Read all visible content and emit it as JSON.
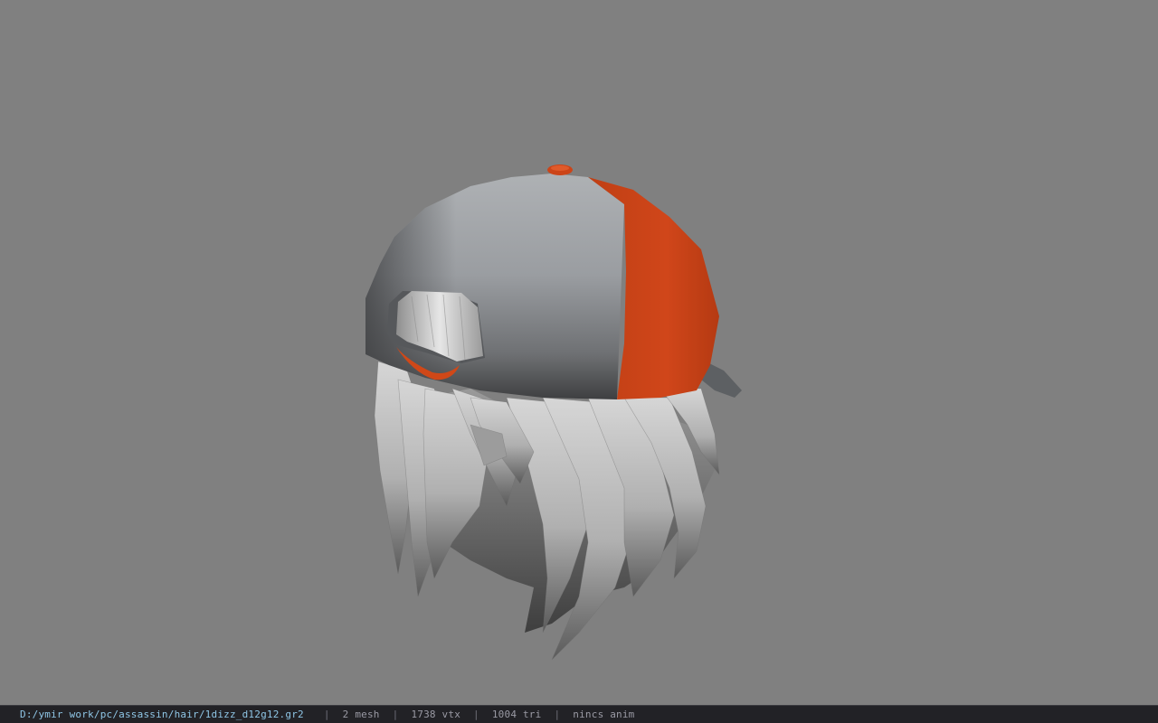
{
  "viewport": {
    "background_color": "#808080",
    "model": {
      "description_icon": "cap-with-hair-model",
      "cap_grey": "#a4a6a8",
      "cap_orange": "#cc4418",
      "hair_grey": "#b8b8b8"
    }
  },
  "status_bar": {
    "file_path": "D:/ymir work/pc/assassin/hair/1dizz_d12g12.gr2",
    "separator": "|",
    "mesh_count": "2 mesh",
    "vertex_count": "1738 vtx",
    "triangle_count": "1004 tri",
    "anim_status": "nincs anim",
    "path_color": "#8fc6e6",
    "text_color": "#9a9aa4"
  }
}
